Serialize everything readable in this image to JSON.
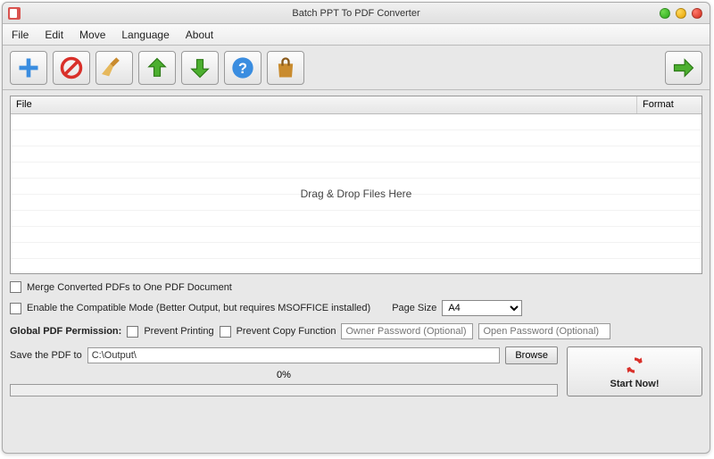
{
  "window": {
    "title": "Batch PPT To PDF Converter"
  },
  "menu": {
    "file": "File",
    "edit": "Edit",
    "move": "Move",
    "language": "Language",
    "about": "About"
  },
  "columns": {
    "file": "File",
    "format": "Format"
  },
  "drag_text": "Drag & Drop Files Here",
  "options": {
    "merge": "Merge Converted PDFs to One PDF Document",
    "compat": "Enable the Compatible Mode (Better Output, but requires MSOFFICE installed)",
    "pagesize_label": "Page Size",
    "pagesize_value": "A4"
  },
  "perm": {
    "label": "Global PDF Permission:",
    "prevent_print": "Prevent Printing",
    "prevent_copy": "Prevent Copy Function",
    "owner_placeholder": "Owner Password (Optional)",
    "open_placeholder": "Open Password (Optional)"
  },
  "save": {
    "label": "Save the PDF to",
    "path": "C:\\Output\\",
    "browse": "Browse"
  },
  "progress": {
    "percent": "0%"
  },
  "start": {
    "label": "Start Now!"
  }
}
